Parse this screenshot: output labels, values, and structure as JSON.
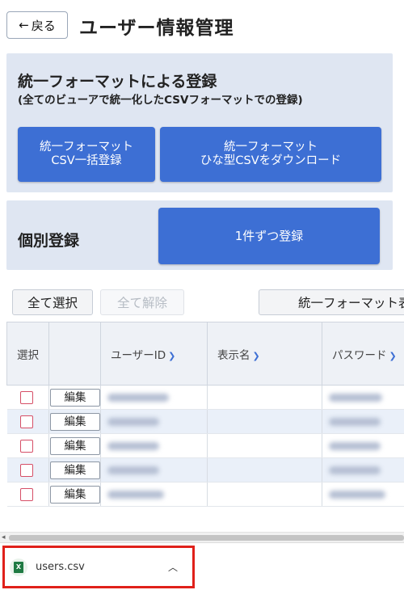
{
  "header": {
    "back_label": "戻る",
    "title": "ユーザー情報管理"
  },
  "unified": {
    "title": "統一フォーマットによる登録",
    "subtitle": "(全てのビューアで統一化したCSVフォーマットでの登録)",
    "bulk_button": "統一フォーマット\nCSV一括登録",
    "template_button": "統一フォーマット\nひな型CSVをダウンロード"
  },
  "individual": {
    "title": "個別登録",
    "one_button": "1件ずつ登録"
  },
  "actions": {
    "select_all": "全て選択",
    "deselect_all": "全て解除",
    "unified_show": "統一フォーマット表"
  },
  "table": {
    "headers": [
      "選択",
      "",
      "ユーザーID",
      "表示名",
      "パスワード"
    ],
    "edit_label": "編集"
  },
  "download": {
    "filename": "users.csv"
  }
}
